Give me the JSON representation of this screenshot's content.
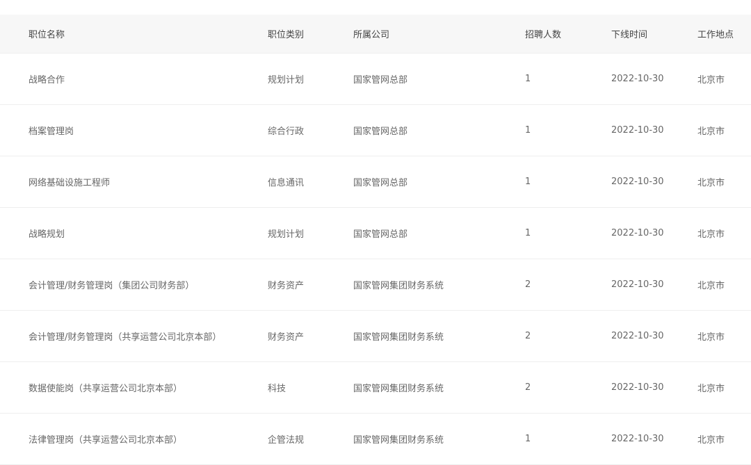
{
  "table": {
    "headers": {
      "name": "职位名称",
      "category": "职位类别",
      "company": "所属公司",
      "count": "招聘人数",
      "offline": "下线时间",
      "location": "工作地点"
    },
    "rows": [
      {
        "name": "战略合作",
        "category": "规划计划",
        "company": "国家管网总部",
        "count": "1",
        "offline": "2022-10-30",
        "location": "北京市"
      },
      {
        "name": "档案管理岗",
        "category": "综合行政",
        "company": "国家管网总部",
        "count": "1",
        "offline": "2022-10-30",
        "location": "北京市"
      },
      {
        "name": "网络基础设施工程师",
        "category": "信息通讯",
        "company": "国家管网总部",
        "count": "1",
        "offline": "2022-10-30",
        "location": "北京市"
      },
      {
        "name": "战略规划",
        "category": "规划计划",
        "company": "国家管网总部",
        "count": "1",
        "offline": "2022-10-30",
        "location": "北京市"
      },
      {
        "name": "会计管理/财务管理岗（集团公司财务部）",
        "category": "财务资产",
        "company": "国家管网集团财务系统",
        "count": "2",
        "offline": "2022-10-30",
        "location": "北京市"
      },
      {
        "name": "会计管理/财务管理岗（共享运营公司北京本部）",
        "category": "财务资产",
        "company": "国家管网集团财务系统",
        "count": "2",
        "offline": "2022-10-30",
        "location": "北京市"
      },
      {
        "name": "数据使能岗（共享运营公司北京本部）",
        "category": "科技",
        "company": "国家管网集团财务系统",
        "count": "2",
        "offline": "2022-10-30",
        "location": "北京市"
      },
      {
        "name": "法律管理岗（共享运营公司北京本部）",
        "category": "企管法规",
        "company": "国家管网集团财务系统",
        "count": "1",
        "offline": "2022-10-30",
        "location": "北京市"
      }
    ]
  }
}
